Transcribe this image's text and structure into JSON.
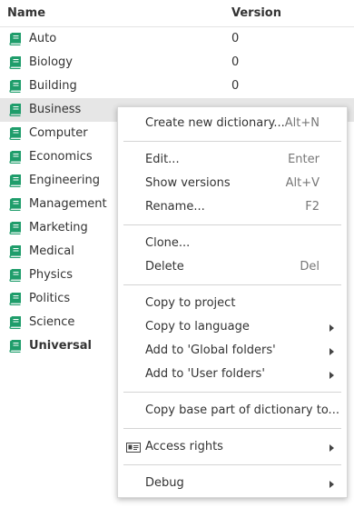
{
  "header": {
    "name_label": "Name",
    "version_label": "Version"
  },
  "dictionaries": [
    {
      "name": "Auto",
      "version": "0",
      "bold": false,
      "selected": false
    },
    {
      "name": "Biology",
      "version": "0",
      "bold": false,
      "selected": false
    },
    {
      "name": "Building",
      "version": "0",
      "bold": false,
      "selected": false
    },
    {
      "name": "Business",
      "version": "",
      "bold": false,
      "selected": true
    },
    {
      "name": "Computer",
      "version": "",
      "bold": false,
      "selected": false
    },
    {
      "name": "Economics",
      "version": "",
      "bold": false,
      "selected": false
    },
    {
      "name": "Engineering",
      "version": "",
      "bold": false,
      "selected": false
    },
    {
      "name": "Management",
      "version": "",
      "bold": false,
      "selected": false
    },
    {
      "name": "Marketing",
      "version": "",
      "bold": false,
      "selected": false
    },
    {
      "name": "Medical",
      "version": "",
      "bold": false,
      "selected": false
    },
    {
      "name": "Physics",
      "version": "",
      "bold": false,
      "selected": false
    },
    {
      "name": "Politics",
      "version": "",
      "bold": false,
      "selected": false
    },
    {
      "name": "Science",
      "version": "",
      "bold": false,
      "selected": false
    },
    {
      "name": "Universal",
      "version": "",
      "bold": true,
      "selected": false
    }
  ],
  "context_menu": {
    "items": [
      {
        "label": "Create new dictionary...",
        "shortcut": "Alt+N"
      },
      {
        "label": "Edit...",
        "shortcut": "Enter"
      },
      {
        "label": "Show versions",
        "shortcut": "Alt+V"
      },
      {
        "label": "Rename...",
        "shortcut": "F2"
      },
      {
        "label": "Clone...",
        "shortcut": ""
      },
      {
        "label": "Delete",
        "shortcut": "Del"
      },
      {
        "label": "Copy to project",
        "shortcut": ""
      },
      {
        "label": "Copy to language",
        "shortcut": "",
        "submenu": true
      },
      {
        "label": "Add to 'Global folders'",
        "shortcut": "",
        "submenu": true
      },
      {
        "label": "Add to 'User folders'",
        "shortcut": "",
        "submenu": true
      },
      {
        "label": "Copy base part of dictionary to...",
        "shortcut": ""
      },
      {
        "label": "Access rights",
        "shortcut": "",
        "submenu": true,
        "icon": "id-card-icon"
      },
      {
        "label": "Debug",
        "shortcut": "",
        "submenu": true
      }
    ]
  },
  "colors": {
    "book_icon": "#1f9d6b",
    "selected_row": "#e6e6e6"
  }
}
